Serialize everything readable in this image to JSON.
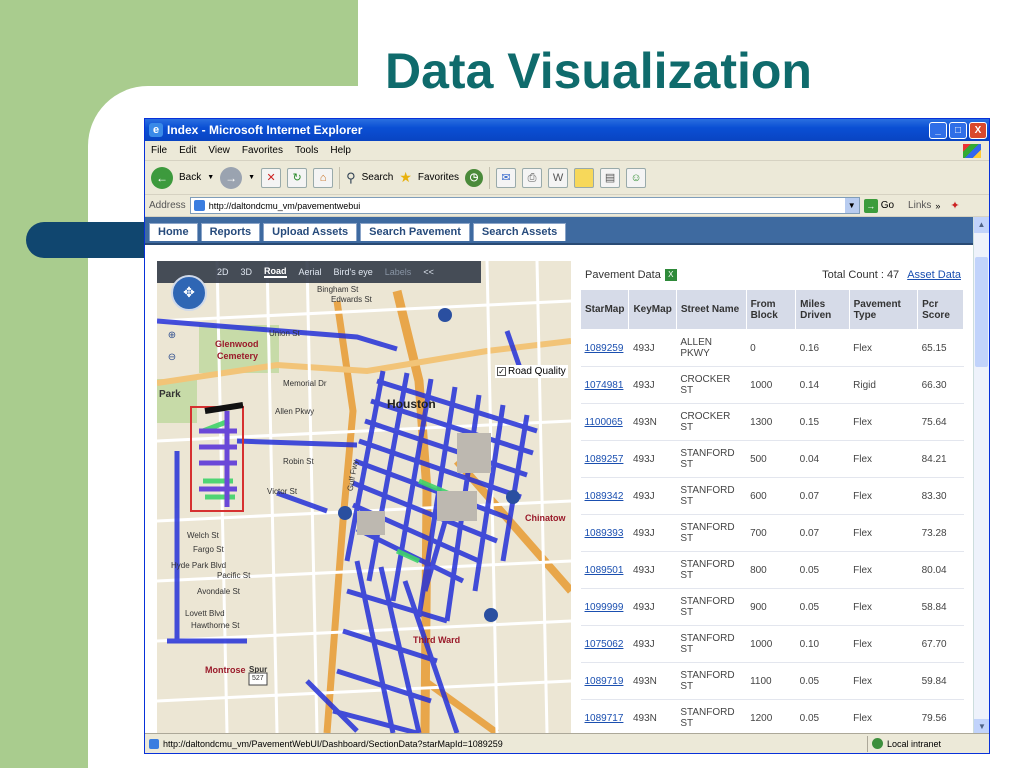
{
  "slide": {
    "title": "Data Visualization"
  },
  "window": {
    "title": "Index - Microsoft Internet Explorer",
    "min": "_",
    "max": "□",
    "close": "X"
  },
  "menu": [
    "File",
    "Edit",
    "View",
    "Favorites",
    "Tools",
    "Help"
  ],
  "toolbar": {
    "back": "Back",
    "search": "Search",
    "favorites": "Favorites"
  },
  "address": {
    "label": "Address",
    "url": "http://daltondcmu_vm/pavementwebui",
    "go": "Go",
    "links": "Links"
  },
  "nav": [
    "Home",
    "Reports",
    "Upload Assets",
    "Search Pavement",
    "Search Assets"
  ],
  "map": {
    "modes": [
      "2D",
      "3D",
      "Road",
      "Aerial",
      "Bird's eye",
      "Labels",
      "<<"
    ],
    "active_mode": "Road",
    "road_quality": "Road Quality",
    "labels": {
      "houston": "Houston",
      "glenwood": "Glenwood",
      "cemetery": "Cemetery",
      "park": "Park",
      "third_ward": "Third Ward",
      "montrose": "Montrose",
      "chinatown": "Chinatow",
      "memorial": "Memorial Dr",
      "allen": "Allen Pkwy",
      "bingham": "Bingham St",
      "edwards": "Edwards St",
      "union": "Union St",
      "robin": "Robin St",
      "victor": "Victor St",
      "fargo": "Fargo St",
      "welch": "Welch St",
      "hyde": "Hyde Park Blvd",
      "pacific": "Pacific St",
      "avondale": "Avondale St",
      "lovett": "Lovett Blvd",
      "hawthorne": "Hawthorne St",
      "spur": "Spur",
      "spur_no": "527",
      "gulf": "Gulf Fwy"
    }
  },
  "panel": {
    "title": "Pavement Data",
    "total_count": "Total Count : 47",
    "asset_link": "Asset Data",
    "columns": [
      "StarMap",
      "KeyMap",
      "Street Name",
      "From Block",
      "Miles Driven",
      "Pavement Type",
      "Pcr Score"
    ],
    "rows": [
      [
        "1089259",
        "493J",
        "ALLEN PKWY",
        "0",
        "0.16",
        "Flex",
        "65.15"
      ],
      [
        "1074981",
        "493J",
        "CROCKER ST",
        "1000",
        "0.14",
        "Rigid",
        "66.30"
      ],
      [
        "1100065",
        "493N",
        "CROCKER ST",
        "1300",
        "0.15",
        "Flex",
        "75.64"
      ],
      [
        "1089257",
        "493J",
        "STANFORD ST",
        "500",
        "0.04",
        "Flex",
        "84.21"
      ],
      [
        "1089342",
        "493J",
        "STANFORD ST",
        "600",
        "0.07",
        "Flex",
        "83.30"
      ],
      [
        "1089393",
        "493J",
        "STANFORD ST",
        "700",
        "0.07",
        "Flex",
        "73.28"
      ],
      [
        "1089501",
        "493J",
        "STANFORD ST",
        "800",
        "0.05",
        "Flex",
        "80.04"
      ],
      [
        "1099999",
        "493J",
        "STANFORD ST",
        "900",
        "0.05",
        "Flex",
        "58.84"
      ],
      [
        "1075062",
        "493J",
        "STANFORD ST",
        "1000",
        "0.10",
        "Flex",
        "67.70"
      ],
      [
        "1089719",
        "493N",
        "STANFORD ST",
        "1100",
        "0.05",
        "Flex",
        "59.84"
      ],
      [
        "1089717",
        "493N",
        "STANFORD ST",
        "1200",
        "0.05",
        "Flex",
        "79.56"
      ]
    ]
  },
  "status": {
    "url": "http://daltondcmu_vm/PavementWebUI/Dashboard/SectionData?starMapId=1089259",
    "zone": "Local intranet"
  },
  "colors": {
    "slide_green": "#a9cc8e",
    "slide_navy": "#10466f",
    "title_teal": "#0f6b6c",
    "nav_blue": "#3e6aa0",
    "road_overlay": "#2430d8",
    "good_overlay": "#3fd36a"
  }
}
